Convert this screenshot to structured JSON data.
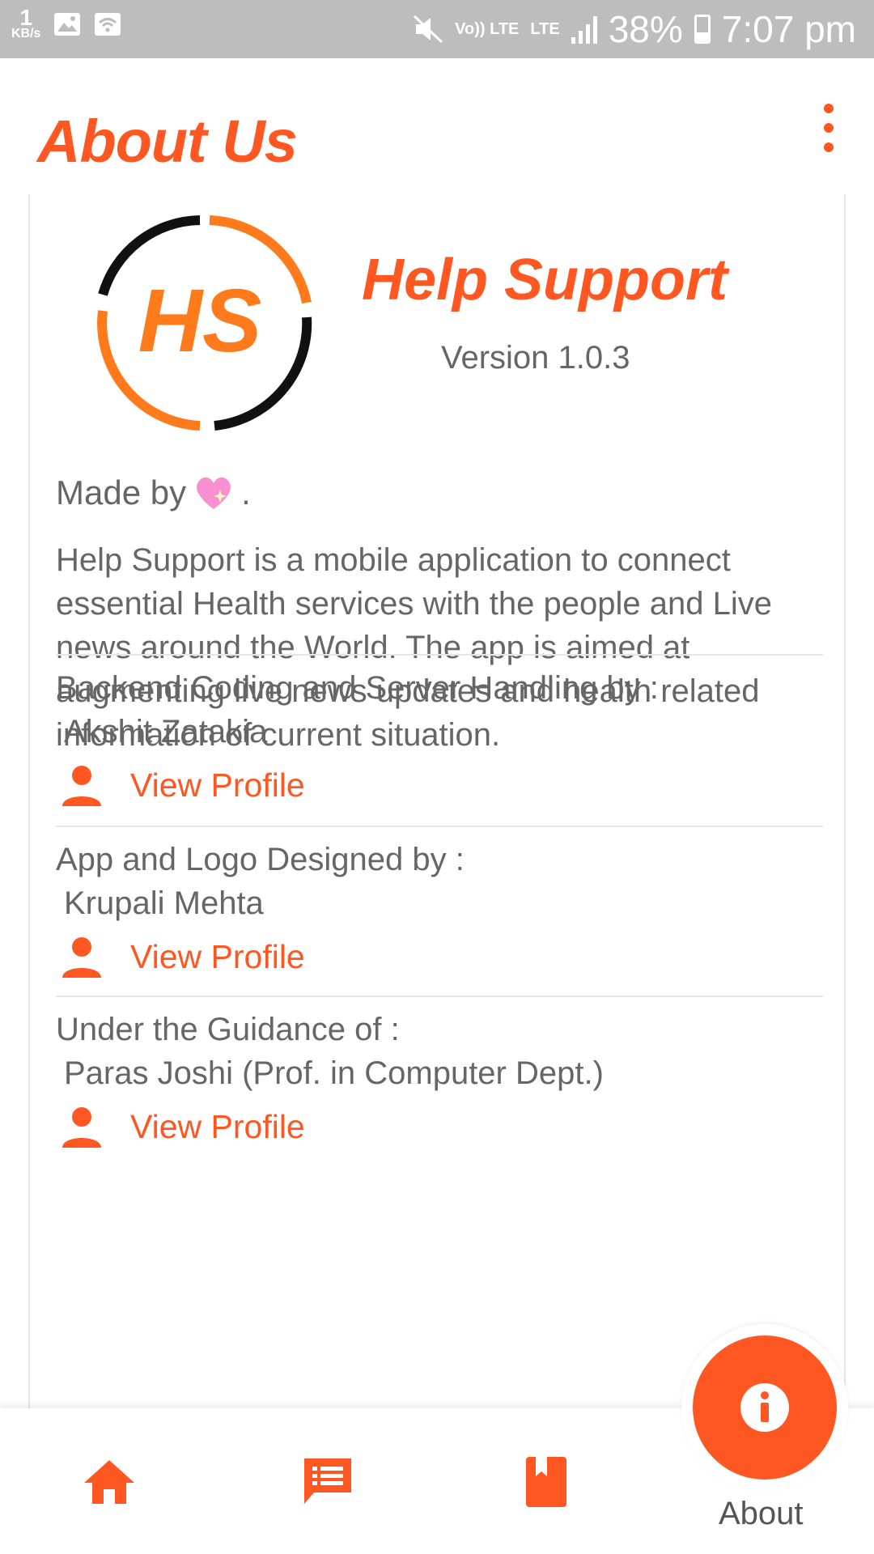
{
  "status_bar": {
    "speed_value": "1",
    "speed_unit": "KB/s",
    "volte": "Vo)) LTE",
    "lte": "LTE",
    "battery": "38%",
    "time": "7:07 pm"
  },
  "header": {
    "title": "About Us",
    "menu_icon": "kebab-menu-icon"
  },
  "app": {
    "name": "Help Support",
    "version": "Version 1.0.3",
    "logo_text": "HS"
  },
  "made_by": {
    "text": "Made by",
    "suffix": "."
  },
  "description": "Help Support is a mobile application to connect essential Health services with the people and Live news around the World. The app is aimed at augmenting live news updates and health related information of current situation.",
  "credits": [
    {
      "role": "Backend Coding and Server Handling by :",
      "name": "Akshit Zatakia",
      "link": "View Profile"
    },
    {
      "role": "App and Logo Designed by :",
      "name": "Krupali Mehta",
      "link": "View Profile"
    },
    {
      "role": "Under the Guidance of :",
      "name": "Paras Joshi (Prof. in Computer Dept.)",
      "link": "View Profile"
    }
  ],
  "bottom_nav": {
    "items": [
      "home-icon",
      "feed-icon",
      "bookmark-icon",
      "info-icon"
    ],
    "active_label": "About"
  },
  "colors": {
    "accent": "#ff5722",
    "text": "#666666",
    "statusbar": "#bdbdbd"
  }
}
